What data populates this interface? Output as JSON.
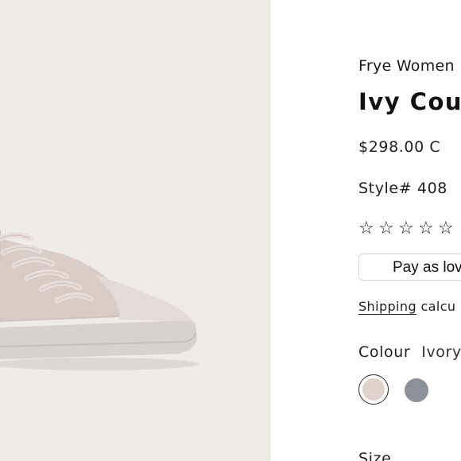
{
  "product": {
    "brand": "Frye Women",
    "title": "Ivy Cour",
    "price": "$298.00 C",
    "style": "Style# 408",
    "rating_stars": "☆☆☆☆☆",
    "pay_label": "Pay as lov",
    "shipping_link": "Shipping",
    "shipping_rest": " calcu",
    "colour_label": "Colour",
    "colour_value": "Ivory",
    "size_label": "Size"
  },
  "colors": {
    "gallery_bg": "#efebe5",
    "swatch_ivory": "#e0d3cb",
    "swatch_grey": "#8c9098"
  },
  "icons": {
    "rating": "star-outline-icon"
  }
}
